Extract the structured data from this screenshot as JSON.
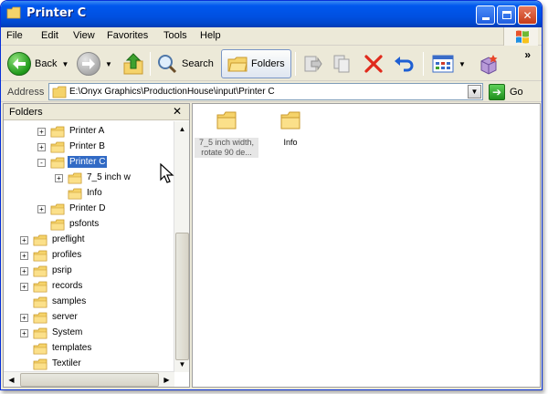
{
  "window": {
    "title": "Printer C"
  },
  "menu": [
    "File",
    "Edit",
    "View",
    "Favorites",
    "Tools",
    "Help"
  ],
  "toolbar": {
    "back": "Back",
    "search": "Search",
    "folders": "Folders"
  },
  "address": {
    "label": "Address",
    "path": "E:\\Onyx Graphics\\ProductionHouse\\input\\Printer C",
    "go": "Go"
  },
  "folders_pane": {
    "title": "Folders",
    "items": [
      {
        "label": "Printer A",
        "expander": "+"
      },
      {
        "label": "Printer B",
        "expander": "+"
      },
      {
        "label": "Printer C",
        "expander": "-",
        "selected": true
      },
      {
        "label": "7_5 inch w",
        "expander": "+"
      },
      {
        "label": "Info",
        "expander": ""
      },
      {
        "label": "Printer D",
        "expander": "+"
      },
      {
        "label": "psfonts",
        "expander": ""
      },
      {
        "label": "preflight",
        "expander": "+"
      },
      {
        "label": "profiles",
        "expander": "+"
      },
      {
        "label": "psrip",
        "expander": "+"
      },
      {
        "label": "records",
        "expander": "+"
      },
      {
        "label": "samples",
        "expander": ""
      },
      {
        "label": "server",
        "expander": "+"
      },
      {
        "label": "System",
        "expander": "+"
      },
      {
        "label": "templates",
        "expander": ""
      },
      {
        "label": "Textiler",
        "expander": ""
      }
    ]
  },
  "content": {
    "items": [
      {
        "label_line1": "7_5 inch width,",
        "label_line2": "rotate 90 de..."
      },
      {
        "label_line1": "Info"
      }
    ]
  },
  "colors": {
    "selection": "#316ac5",
    "folder_body": "#f5d36a",
    "folder_edge": "#c99a2e"
  }
}
